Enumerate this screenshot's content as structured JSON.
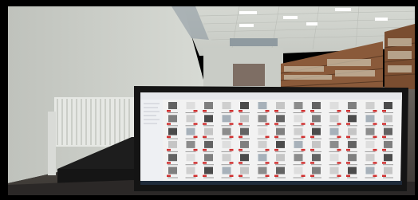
{
  "photo": {
    "subject": "library-reading-room-with-computer-monitor",
    "monitor_content": "file-browser-thumbnail-grid",
    "colors": {
      "border": "#000000",
      "wall": "#cfd2cc",
      "ceiling": "#d9dcd6",
      "floor": "#4a4642",
      "shelf_wood": "#8a5a3a",
      "monitor_bezel": "#141414",
      "screen_bg": "#f2f2f2",
      "radiator": "#e6e8e4",
      "thumb_red": "#d03030"
    }
  }
}
